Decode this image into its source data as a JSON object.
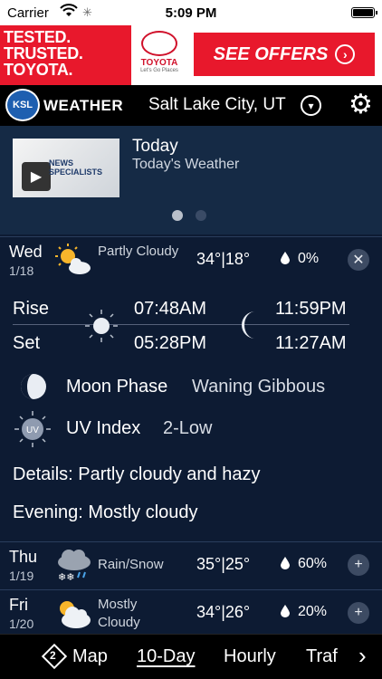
{
  "status": {
    "carrier": "Carrier",
    "time": "5:09 PM"
  },
  "ad": {
    "headline": "TESTED. TRUSTED. TOYOTA.",
    "brand": "TOYOTA",
    "tagline": "Let's Go Places",
    "cta": "SEE OFFERS"
  },
  "header": {
    "logo": "KSL",
    "logo_suffix": "WEATHER",
    "city": "Salt Lake City, UT"
  },
  "video": {
    "title": "Today",
    "subtitle": "Today's Weather",
    "thumb_text": "NEWS SPECIALISTS"
  },
  "days": [
    {
      "name": "Wed",
      "date": "1/18",
      "icon": "partly-cloudy-icon",
      "condition": "Partly Cloudy",
      "temps": "34°|18°",
      "precip": "0%",
      "action": "✕"
    },
    {
      "name": "Thu",
      "date": "1/19",
      "icon": "rain-snow-icon",
      "condition": "Rain/Snow",
      "temps": "35°|25°",
      "precip": "60%",
      "action": "+"
    },
    {
      "name": "Fri",
      "date": "1/20",
      "icon": "mostly-cloudy-icon",
      "condition": "Mostly Cloudy",
      "temps": "34°|26°",
      "precip": "20%",
      "action": "+"
    }
  ],
  "details": {
    "rise_label": "Rise",
    "set_label": "Set",
    "sunrise": "07:48AM",
    "sunset": "05:28PM",
    "moonrise": "11:59PM",
    "moonset": "11:27AM",
    "moon_phase_label": "Moon Phase",
    "moon_phase": "Waning Gibbous",
    "uv_label": "UV Index",
    "uv_value": "2-Low",
    "uv_badge": "UV",
    "details_text": "Details: Partly cloudy and hazy",
    "evening_text": "Evening: Mostly cloudy"
  },
  "tabs": {
    "map_badge": "2",
    "map": "Map",
    "ten_day": "10-Day",
    "hourly": "Hourly",
    "traffic": "Traf"
  },
  "colors": {
    "background": "#0d1b33",
    "header": "#000000",
    "ad_red": "#e8182c",
    "card": "#152a45"
  }
}
